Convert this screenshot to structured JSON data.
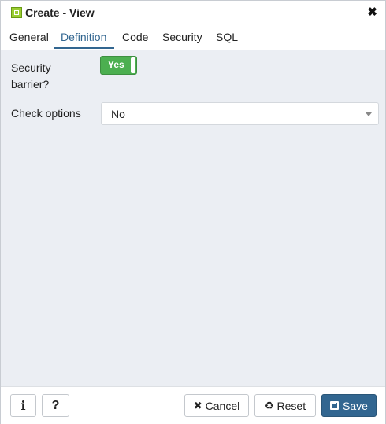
{
  "dialog": {
    "title": "Create - View",
    "close_icon": "close-icon"
  },
  "tabs": [
    {
      "label": "General",
      "active": false
    },
    {
      "label": "Definition",
      "active": true
    },
    {
      "label": "Code",
      "active": false
    },
    {
      "label": "Security",
      "active": false
    },
    {
      "label": "SQL",
      "active": false
    }
  ],
  "form": {
    "security_barrier": {
      "label_line1": "Security",
      "label_line2": "barrier?",
      "value": "Yes"
    },
    "check_options": {
      "label": "Check options",
      "value": "No"
    }
  },
  "footer": {
    "info_label": "i",
    "help_label": "?",
    "cancel_label": "Cancel",
    "reset_label": "Reset",
    "save_label": "Save"
  },
  "colors": {
    "accent": "#326690",
    "toggle_on": "#4caf50",
    "content_bg": "#ebeef3"
  }
}
